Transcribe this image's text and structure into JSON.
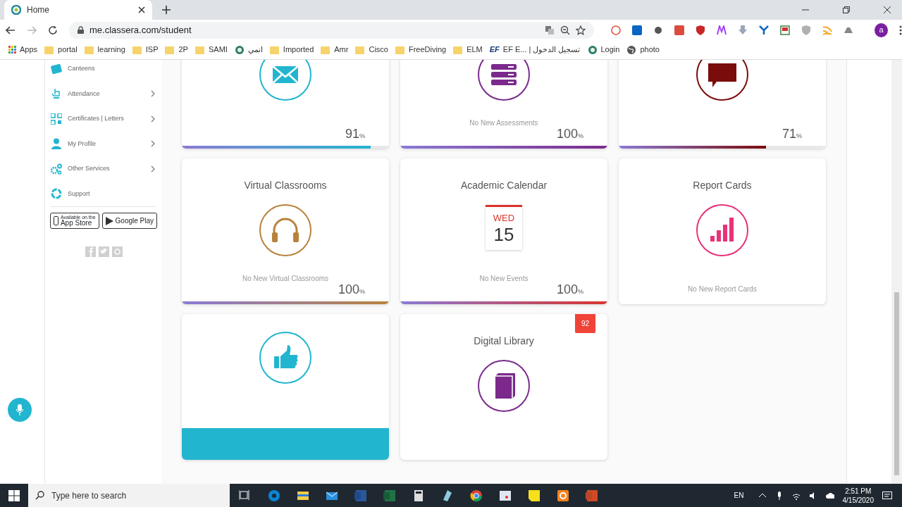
{
  "browser": {
    "tab": {
      "title": "Home"
    },
    "url": "me.classera.com/student",
    "profile_initial": "a",
    "bookmarks": [
      {
        "label": "Apps",
        "kind": "apps"
      },
      {
        "label": "portal",
        "kind": "folder"
      },
      {
        "label": "learning",
        "kind": "folder"
      },
      {
        "label": "ISP",
        "kind": "folder"
      },
      {
        "label": "2P",
        "kind": "folder"
      },
      {
        "label": "SAMI",
        "kind": "folder"
      },
      {
        "label": "انمي",
        "kind": "site"
      },
      {
        "label": "Imported",
        "kind": "folder"
      },
      {
        "label": "Amr",
        "kind": "folder"
      },
      {
        "label": "Cisco",
        "kind": "folder"
      },
      {
        "label": "FreeDiving",
        "kind": "folder"
      },
      {
        "label": "ELM",
        "kind": "folder"
      },
      {
        "label": "EF E... | تسجيل الدخول",
        "kind": "ef",
        "icon_text": "EF"
      },
      {
        "label": "Login",
        "kind": "site"
      },
      {
        "label": "photo",
        "kind": "globe"
      }
    ]
  },
  "sidebar": {
    "items": [
      {
        "label": "Canteens",
        "kind": "canteen",
        "has_submenu": false
      },
      {
        "label": "Attendance",
        "kind": "hand",
        "has_submenu": true
      },
      {
        "label": "Certificates | Letters",
        "kind": "qr",
        "has_submenu": true
      },
      {
        "label": "My Profile",
        "kind": "person",
        "has_submenu": true
      },
      {
        "label": "Other Services",
        "kind": "gears",
        "has_submenu": true
      },
      {
        "label": "Support",
        "kind": "lifebuoy",
        "has_submenu": false
      }
    ],
    "stores": [
      {
        "small": "Available on the",
        "big": "App Store",
        "kind": "apple"
      },
      {
        "big": "Google Play",
        "kind": "play"
      }
    ]
  },
  "cards": [
    {
      "kind": "mail",
      "color": "#22b5cf",
      "percent": "91",
      "unit": "%",
      "level": 0.91
    },
    {
      "kind": "assessments",
      "color": "#7b2a8c",
      "caption": "No New Assessments",
      "percent": "100",
      "unit": "%",
      "level": 1
    },
    {
      "kind": "chat",
      "color": "#7a0c0c",
      "percent": "71",
      "unit": "%",
      "level": 0.71
    },
    {
      "title": "Virtual Classrooms",
      "kind": "headphones",
      "color": "#b8823c",
      "caption": "No New Virtual Classrooms",
      "percent": "100",
      "unit": "%",
      "level": 1
    },
    {
      "title": "Academic Calendar",
      "kind": "calendar",
      "color": "#d9342b",
      "calendar": {
        "weekday": "WED",
        "day": "15"
      },
      "caption": "No New Events",
      "percent": "100",
      "unit": "%",
      "level": 1
    },
    {
      "title": "Report Cards",
      "kind": "chart",
      "color": "#e8327a",
      "caption": "No New Report Cards"
    },
    {
      "kind": "thumbs",
      "color": "#22b5cf",
      "footer_band": true
    },
    {
      "title": "Digital Library",
      "kind": "book",
      "color": "#7b2a8c",
      "badge": "92"
    }
  ],
  "taskbar": {
    "search_placeholder": "Type here to search",
    "language": "EN",
    "time": "2:51 PM",
    "date": "4/15/2020"
  }
}
